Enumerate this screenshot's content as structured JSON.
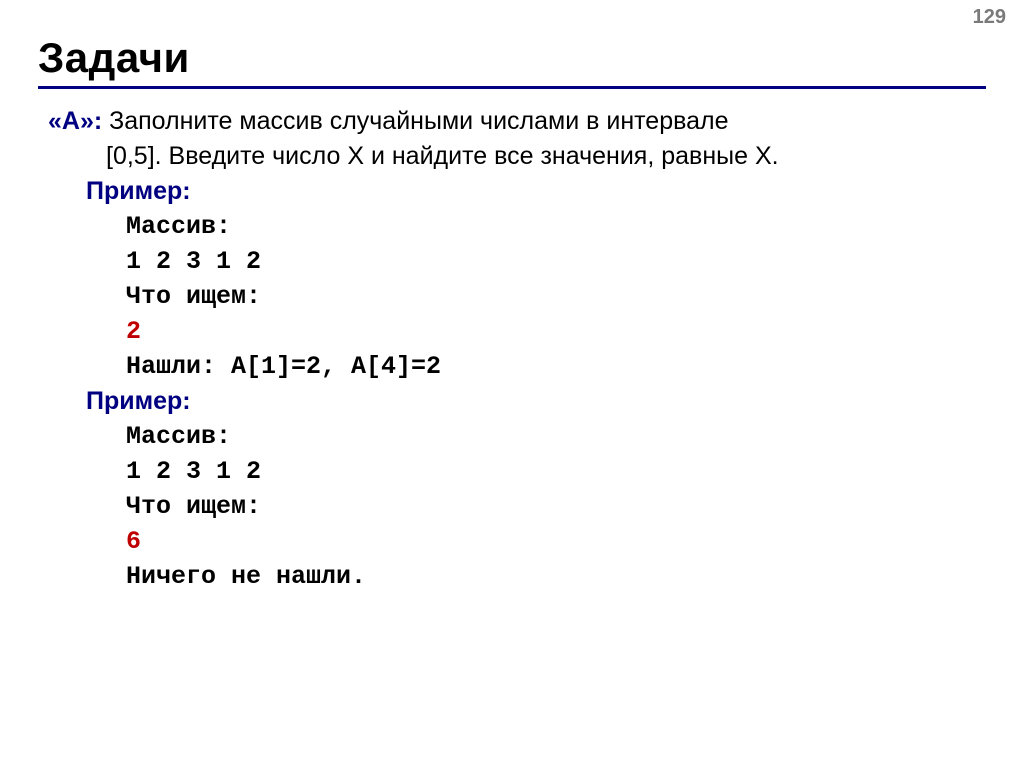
{
  "page_number": "129",
  "title": "Задачи",
  "task": {
    "label": "«A»:",
    "text_line1": " Заполните массив случайными числами в интервале",
    "text_line2": "[0,5]. Введите число X и найдите все значения, равные X."
  },
  "examples": [
    {
      "label": "Пример:",
      "lines": [
        {
          "text": "Массив:",
          "red": false
        },
        {
          "text": "1 2 3 1 2",
          "red": false
        },
        {
          "text": "Что ищем:",
          "red": false
        },
        {
          "text": "2",
          "red": true
        },
        {
          "text": "Нашли: A[1]=2, A[4]=2",
          "red": false
        }
      ]
    },
    {
      "label": "Пример:",
      "lines": [
        {
          "text": "Массив:",
          "red": false
        },
        {
          "text": "1 2 3 1 2",
          "red": false
        },
        {
          "text": "Что ищем:",
          "red": false
        },
        {
          "text": "6",
          "red": true
        },
        {
          "text": "Ничего не нашли.",
          "red": false
        }
      ]
    }
  ]
}
